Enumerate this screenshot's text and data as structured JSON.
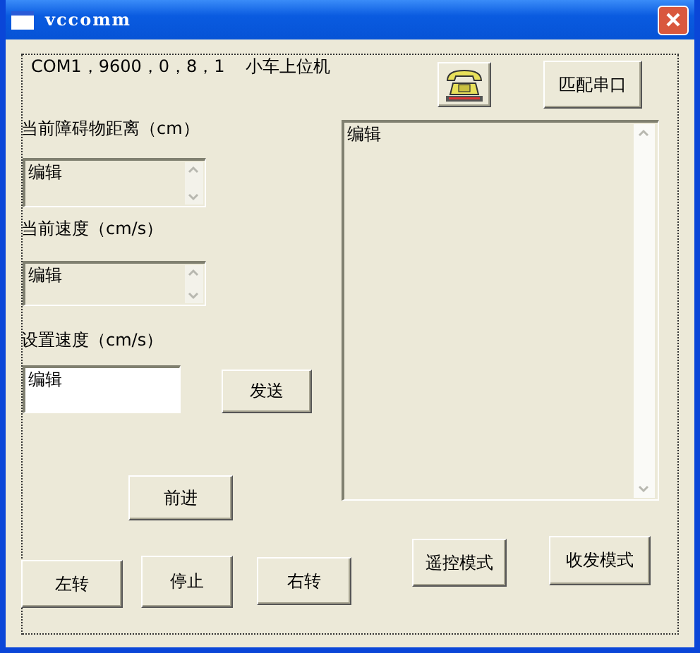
{
  "window": {
    "title": "vccomm"
  },
  "header": {
    "port_settings": "COM1，9600，0，8，1",
    "app_name": "小车上位机"
  },
  "fields": [
    {
      "label": "当前障碍物距离（cm）",
      "value": "编辑",
      "readonly": true
    },
    {
      "label": "当前速度（cm/s）",
      "value": "编辑",
      "readonly": true
    },
    {
      "label": "设置速度（cm/s）",
      "value": "编辑",
      "readonly": false
    }
  ],
  "log": {
    "value": "编辑",
    "readonly": true
  },
  "buttons": [
    {
      "kind": "icon"
    },
    {
      "kind": "text",
      "label": "匹配串口"
    },
    {
      "kind": "text",
      "label": "发送"
    },
    {
      "kind": "text",
      "label": "前进"
    },
    {
      "kind": "text",
      "label": "左转"
    },
    {
      "kind": "text",
      "label": "停止"
    },
    {
      "kind": "text",
      "label": "右转"
    },
    {
      "kind": "text",
      "label": "遥控模式"
    },
    {
      "kind": "text",
      "label": "收发模式"
    }
  ]
}
